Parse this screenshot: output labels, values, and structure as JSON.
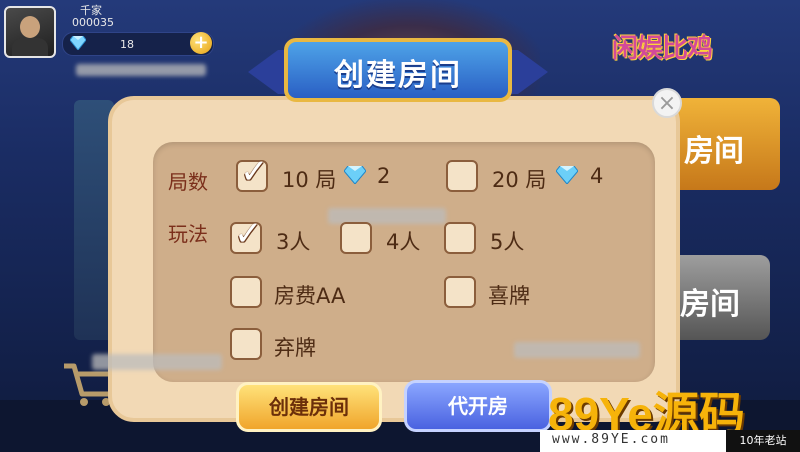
{
  "header": {
    "username": "千家",
    "user_id": "000035",
    "gem_count": "18",
    "add_label": "+",
    "logo_text": "闲娱比鸡"
  },
  "background": {
    "right_card_1_label": "房间",
    "right_card_2_label": "房间"
  },
  "dialog": {
    "title": "创建房间",
    "close_label": "×",
    "rounds": {
      "label": "局数",
      "options": [
        {
          "text": "10 局",
          "cost": "2",
          "checked": true
        },
        {
          "text": "20 局",
          "cost": "4",
          "checked": false
        }
      ]
    },
    "play": {
      "label": "玩法",
      "players": [
        {
          "text": "3人",
          "checked": true
        },
        {
          "text": "4人",
          "checked": false
        },
        {
          "text": "5人",
          "checked": false
        }
      ],
      "extras": [
        {
          "text": "房费AA",
          "checked": false
        },
        {
          "text": "喜牌",
          "checked": false
        },
        {
          "text": "弃牌",
          "checked": false
        }
      ]
    },
    "create_button": "创建房间",
    "proxy_button": "代开房"
  },
  "watermark": {
    "main": "89Ye源码",
    "url": "www.89YE.com",
    "tag": "10年老站"
  },
  "colors": {
    "accent_gold": "#f0a52b",
    "accent_blue": "#4a62e0",
    "dialog_bg": "#f2d9b5",
    "panel_bg": "#cfae8a",
    "label_red": "#7b2f1b"
  }
}
